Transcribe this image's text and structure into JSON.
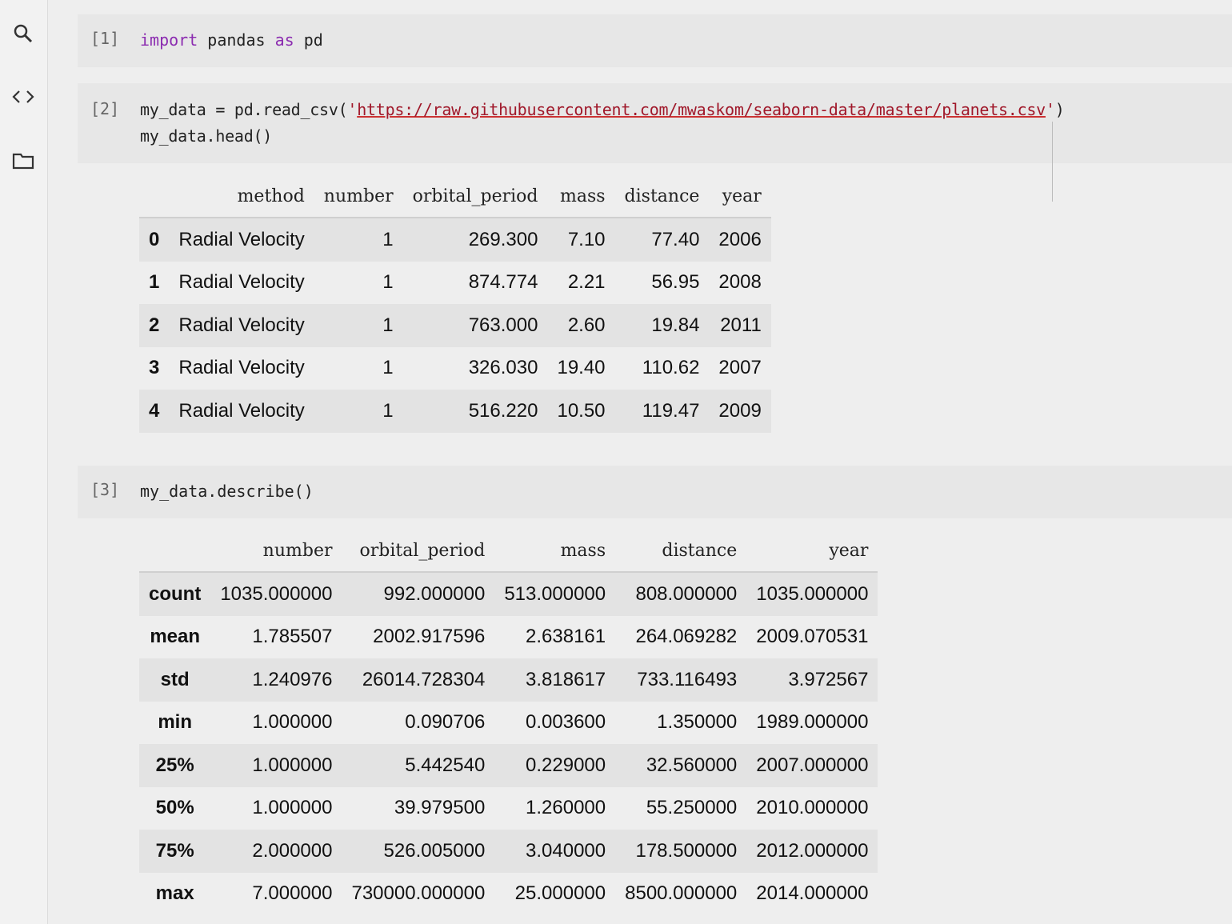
{
  "cells": [
    {
      "number": "[1]",
      "lines": []
    },
    {
      "number": "[2]"
    },
    {
      "number": "[3]"
    }
  ],
  "cell1": {
    "kw_import": "import",
    "mod": " pandas ",
    "kw_as": "as",
    "alias": " pd"
  },
  "cell2": {
    "pre": "my_data = pd.read_csv(",
    "quote_open": "'",
    "url": "https://raw.githubusercontent.com/mwaskom/seaborn-data/master/planets.csv",
    "quote_close": "'",
    "post": ")",
    "line2": "my_data.head()"
  },
  "cell3": {
    "line1": "my_data.describe()"
  },
  "head_table": {
    "columns": [
      "",
      "method",
      "number",
      "orbital_period",
      "mass",
      "distance",
      "year"
    ],
    "rows": [
      [
        "0",
        "Radial Velocity",
        "1",
        "269.300",
        "7.10",
        "77.40",
        "2006"
      ],
      [
        "1",
        "Radial Velocity",
        "1",
        "874.774",
        "2.21",
        "56.95",
        "2008"
      ],
      [
        "2",
        "Radial Velocity",
        "1",
        "763.000",
        "2.60",
        "19.84",
        "2011"
      ],
      [
        "3",
        "Radial Velocity",
        "1",
        "326.030",
        "19.40",
        "110.62",
        "2007"
      ],
      [
        "4",
        "Radial Velocity",
        "1",
        "516.220",
        "10.50",
        "119.47",
        "2009"
      ]
    ]
  },
  "describe_table": {
    "columns": [
      "",
      "number",
      "orbital_period",
      "mass",
      "distance",
      "year"
    ],
    "rows": [
      [
        "count",
        "1035.000000",
        "992.000000",
        "513.000000",
        "808.000000",
        "1035.000000"
      ],
      [
        "mean",
        "1.785507",
        "2002.917596",
        "2.638161",
        "264.069282",
        "2009.070531"
      ],
      [
        "std",
        "1.240976",
        "26014.728304",
        "3.818617",
        "733.116493",
        "3.972567"
      ],
      [
        "min",
        "1.000000",
        "0.090706",
        "0.003600",
        "1.350000",
        "1989.000000"
      ],
      [
        "25%",
        "1.000000",
        "5.442540",
        "0.229000",
        "32.560000",
        "2007.000000"
      ],
      [
        "50%",
        "1.000000",
        "39.979500",
        "1.260000",
        "55.250000",
        "2010.000000"
      ],
      [
        "75%",
        "2.000000",
        "526.005000",
        "3.040000",
        "178.500000",
        "2012.000000"
      ],
      [
        "max",
        "7.000000",
        "730000.000000",
        "25.000000",
        "8500.000000",
        "2014.000000"
      ]
    ]
  },
  "colors": {
    "keyword": "#8b2bb0",
    "string": "#a0182a",
    "cell_bg": "#e7e7e7"
  }
}
